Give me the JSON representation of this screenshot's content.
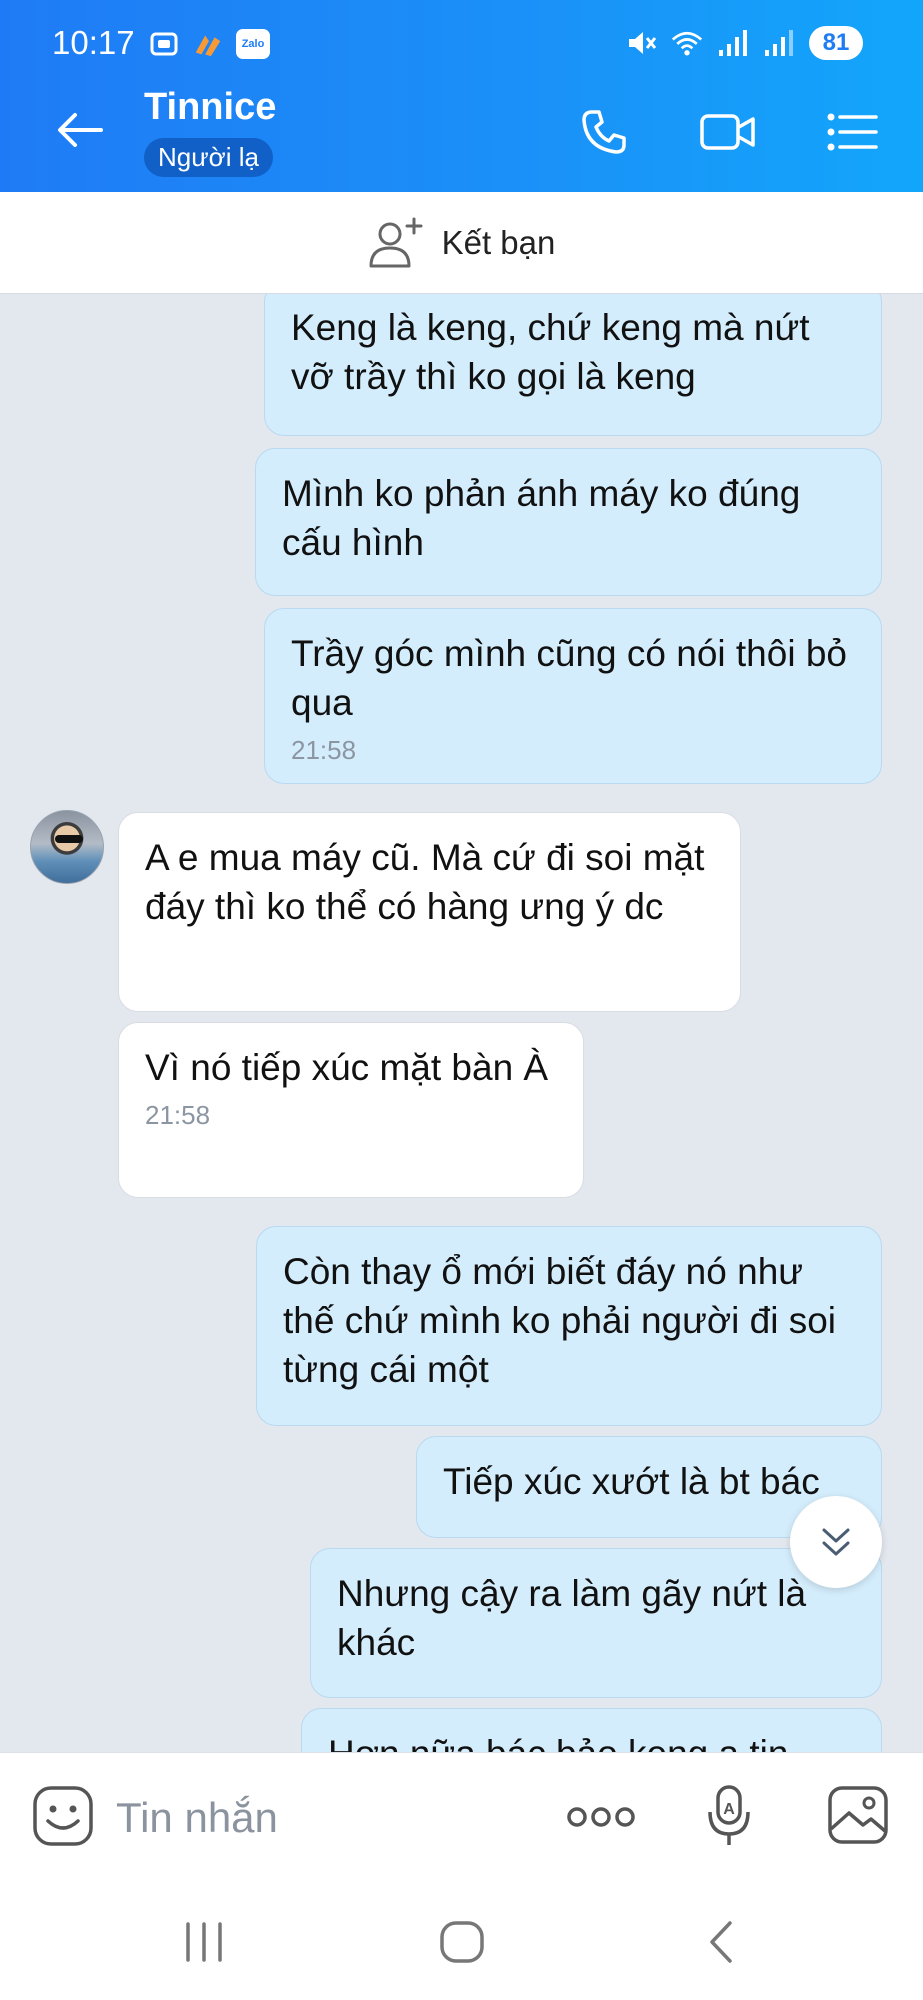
{
  "status_bar": {
    "time": "10:17",
    "zalo_badge": "Zalo",
    "battery": "81"
  },
  "header": {
    "contact_name": "Tinnice",
    "contact_status": "Người lạ",
    "icons": [
      "back-arrow-icon",
      "phone-icon",
      "video-call-icon",
      "menu-list-icon"
    ]
  },
  "friend_bar": {
    "label": "Kết bạn"
  },
  "messages": [
    {
      "direction": "out",
      "text": "Keng là keng, chứ keng mà nứt vỡ trầy thì ko gọi là keng",
      "time": ""
    },
    {
      "direction": "out",
      "text": "Mình ko phản ánh máy ko đúng cấu hình",
      "time": ""
    },
    {
      "direction": "out",
      "text": "Trầy góc mình cũng có nói thôi bỏ qua",
      "time": "21:58"
    },
    {
      "direction": "in",
      "text": "A e mua máy cũ. Mà cứ đi soi mặt đáy thì ko thể có hàng ưng ý dc",
      "time": ""
    },
    {
      "direction": "in",
      "text": "Vì nó tiếp xúc mặt bàn À",
      "time": "21:58"
    },
    {
      "direction": "out",
      "text": "Còn thay ổ mới biết đáy nó như thế chứ mình ko phải người đi soi từng cái một",
      "time": ""
    },
    {
      "direction": "out",
      "text": "Tiếp xúc xướt là bt bác",
      "time": ""
    },
    {
      "direction": "out",
      "text": "Nhưng cậy ra làm gãy nứt là khác",
      "time": ""
    },
    {
      "direction": "out",
      "text": "Hơn nữa bác bảo keng ạ tin",
      "time": ""
    }
  ],
  "input_bar": {
    "placeholder": "Tin nhắn",
    "icons": [
      "sticker-icon",
      "more-options-icon",
      "voice-input-icon",
      "image-icon"
    ]
  },
  "nav_bar": {
    "icons": [
      "recent-apps-icon",
      "home-icon",
      "back-icon"
    ]
  },
  "colors": {
    "header_gradient_start": "#1f7bf5",
    "header_gradient_end": "#12a6fb",
    "outgoing_bubble": "#d4edfc",
    "incoming_bubble": "#ffffff",
    "chat_background": "#e3e8ef"
  }
}
